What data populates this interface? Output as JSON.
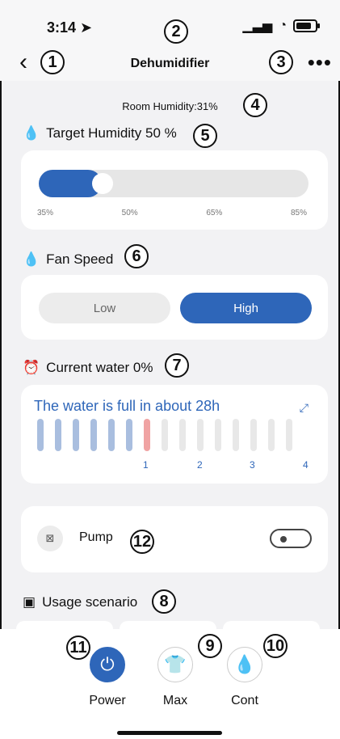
{
  "status_bar": {
    "time": "3:14",
    "location_icon": "location-arrow-icon",
    "signal_icon": "cellular-signal-icon",
    "wifi_icon": "wifi-icon",
    "battery_icon": "battery-icon"
  },
  "header": {
    "title": "Dehumidifier",
    "back_icon": "chevron-left-icon",
    "more_icon": "more-horizontal-icon"
  },
  "room_humidity": "Room Humidity:31%",
  "target": {
    "title": "Target Humidity 50 %",
    "ticks": [
      "35%",
      "50%",
      "65%",
      "85%"
    ],
    "slider_value_percent": 50
  },
  "fan": {
    "title": "Fan Speed",
    "options": [
      "Low",
      "High"
    ],
    "selected": "High"
  },
  "water": {
    "title": "Current water 0%",
    "message": "The water is full in about 28h",
    "scale": [
      "1",
      "2",
      "3",
      "4"
    ],
    "expand_icon": "expand-arrows-icon"
  },
  "pump": {
    "label": "Pump",
    "icon": "pump-icon",
    "toggle_on": false
  },
  "usage": {
    "title": "Usage scenario",
    "icon": "book-icon"
  },
  "dock": {
    "items": [
      {
        "label": "Power",
        "icon": "power-icon"
      },
      {
        "label": "Max",
        "icon": "shirt-icon"
      },
      {
        "label": "Cont",
        "icon": "water-drop-icon"
      }
    ]
  },
  "annotations": [
    "1",
    "2",
    "3",
    "4",
    "5",
    "6",
    "7",
    "8",
    "9",
    "10",
    "11",
    "12"
  ],
  "colors": {
    "accent": "#2e66b9",
    "background": "#f2f2f4",
    "card": "#ffffff"
  }
}
